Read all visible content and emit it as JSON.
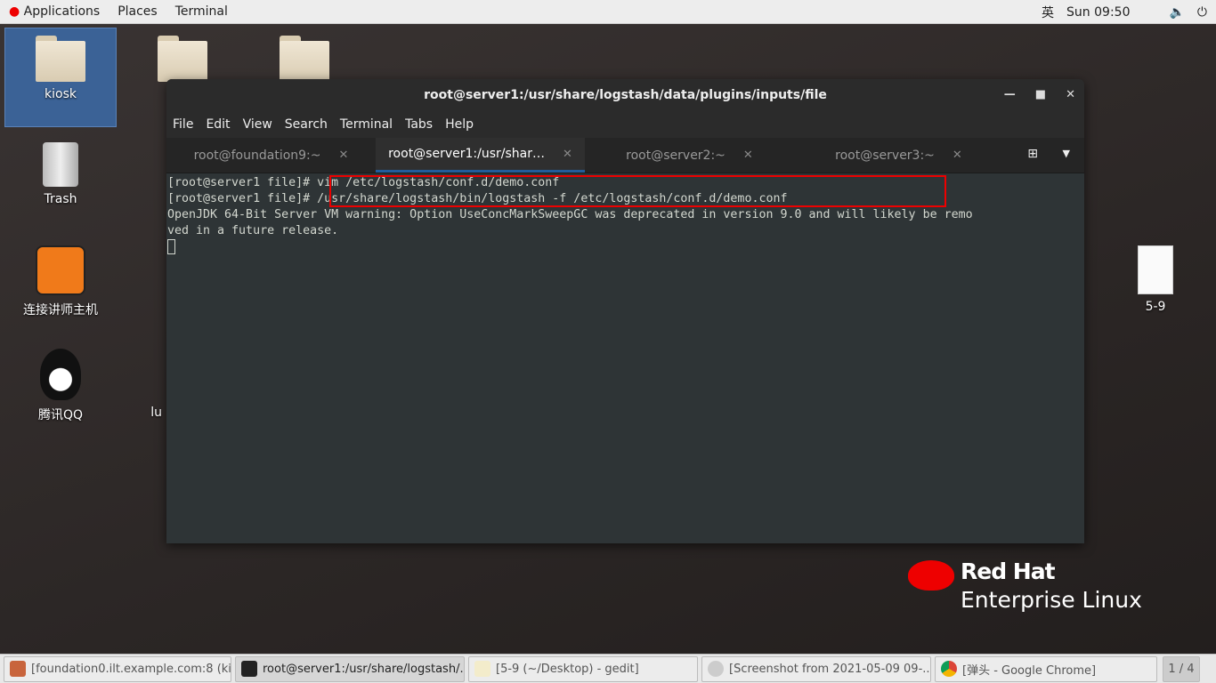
{
  "topbar": {
    "applications": "Applications",
    "places": "Places",
    "terminal": "Terminal",
    "input_method": "英",
    "clock": "Sun 09:50"
  },
  "desktop": {
    "icons": [
      {
        "label": "kiosk"
      },
      {
        "label": "Trash"
      },
      {
        "label": "连接讲师主机"
      },
      {
        "label": "腾讯QQ"
      },
      {
        "label": "lu"
      },
      {
        "label": "5-9"
      }
    ]
  },
  "window": {
    "title": "root@server1:/usr/share/logstash/data/plugins/inputs/file",
    "menu": [
      "File",
      "Edit",
      "View",
      "Search",
      "Terminal",
      "Tabs",
      "Help"
    ],
    "tabs": [
      {
        "label": "root@foundation9:~"
      },
      {
        "label": "root@server1:/usr/shar…"
      },
      {
        "label": "root@server2:~"
      },
      {
        "label": "root@server3:~"
      }
    ],
    "terminal_lines": [
      "[root@server1 file]# vim /etc/logstash/conf.d/demo.conf",
      "[root@server1 file]# /usr/share/logstash/bin/logstash -f /etc/logstash/conf.d/demo.conf",
      "OpenJDK 64-Bit Server VM warning: Option UseConcMarkSweepGC was deprecated in version 9.0 and will likely be remo",
      "ved in a future release."
    ]
  },
  "brand": {
    "line1": "Red Hat",
    "line2": "Enterprise Linux"
  },
  "taskbar": {
    "items": [
      {
        "label": "[foundation0.ilt.example.com:8 (kio..."
      },
      {
        "label": "root@server1:/usr/share/logstash/..."
      },
      {
        "label": "[5-9 (~/Desktop) - gedit]"
      },
      {
        "label": "[Screenshot from 2021-05-09 09-..."
      },
      {
        "label": "[弹头 - Google Chrome]"
      }
    ],
    "workspace": "1 / 4"
  },
  "colors": {
    "highlight": "#e00000",
    "accent": "#215d9c",
    "redhat": "#ee0000"
  }
}
